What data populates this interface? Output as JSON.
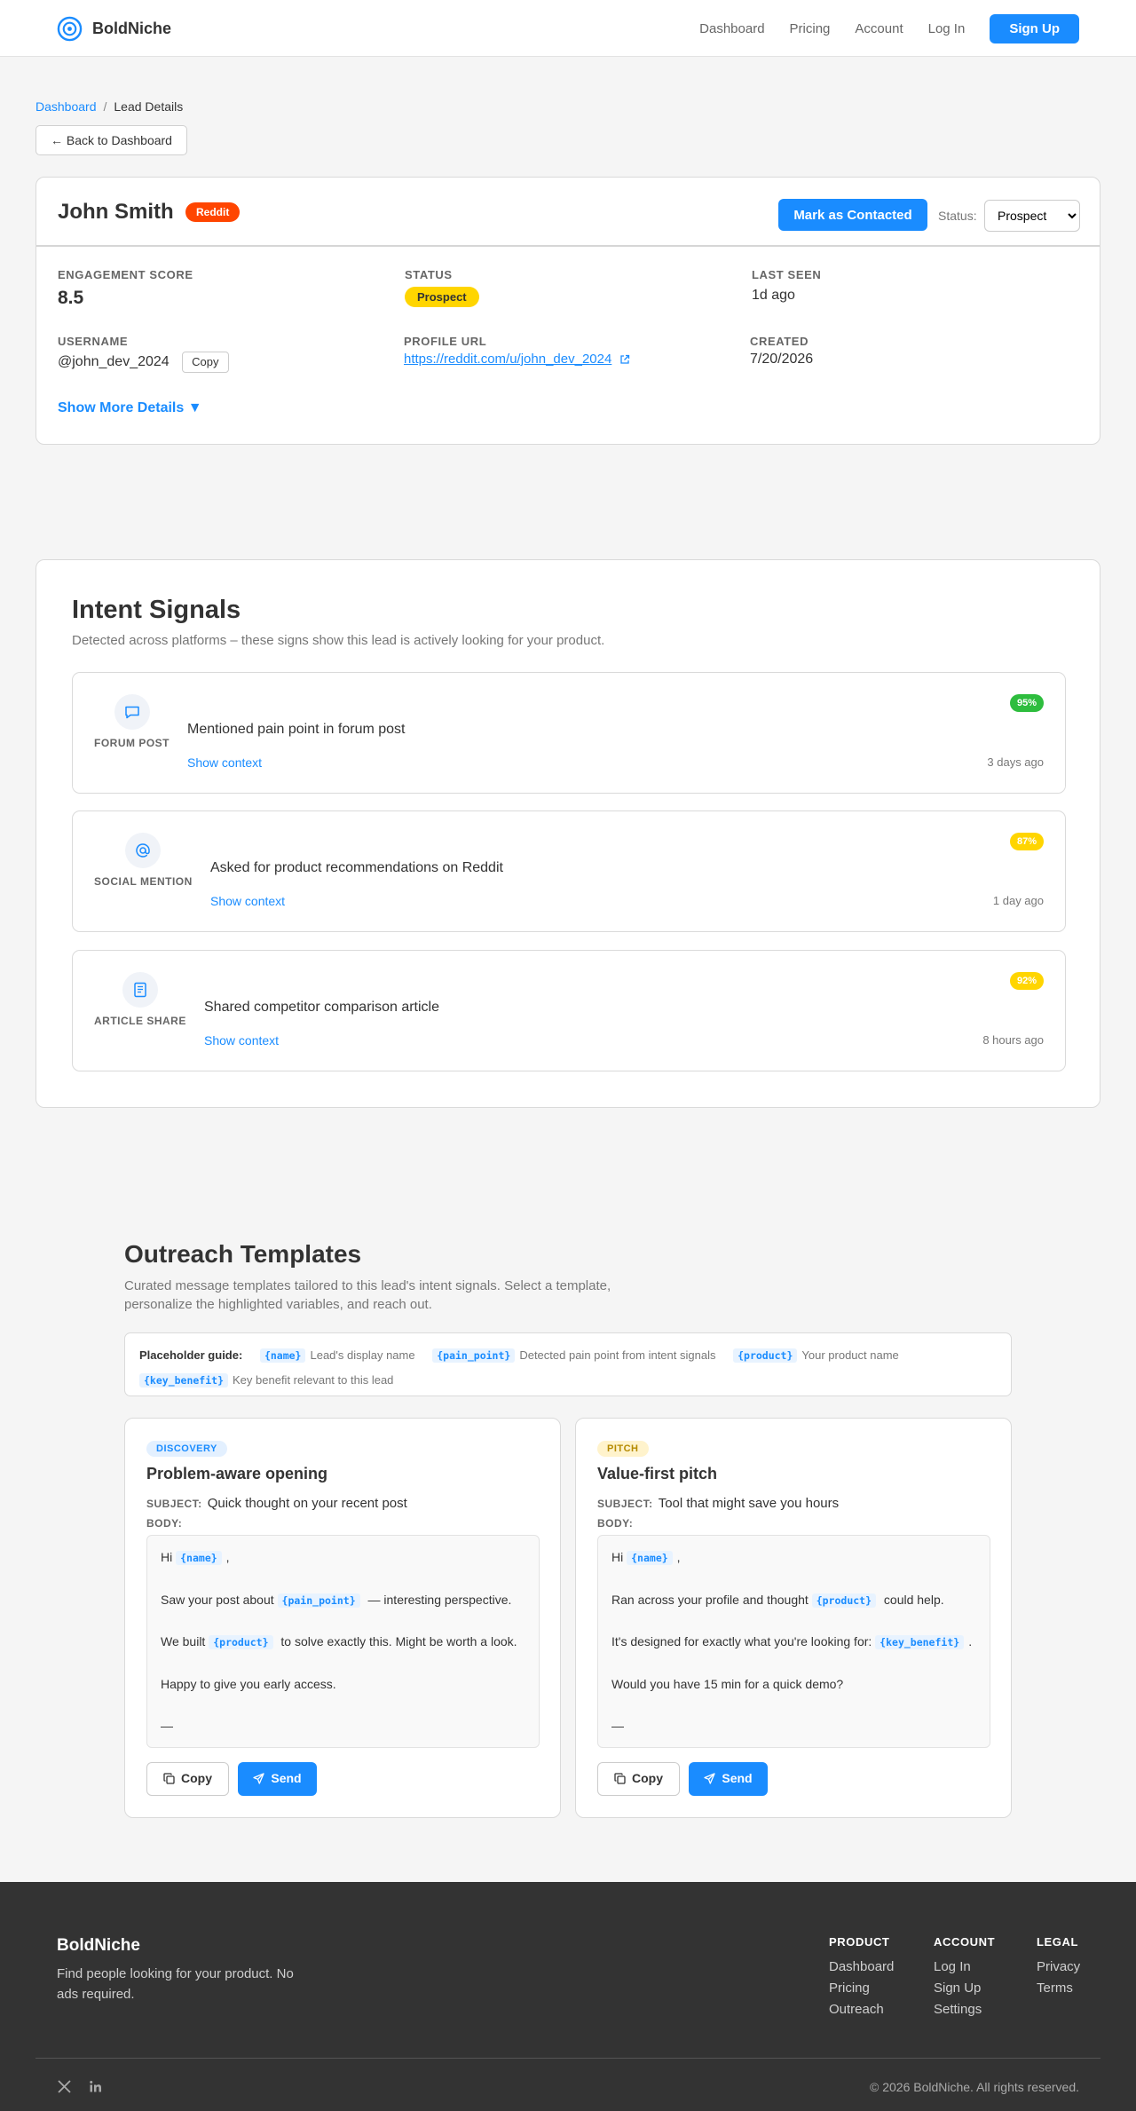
{
  "nav": {
    "brand": "BoldNiche",
    "links": [
      "Dashboard",
      "Pricing",
      "Account",
      "Log In"
    ],
    "signup": "Sign Up"
  },
  "breadcrumb": {
    "parent": "Dashboard",
    "separator": "/",
    "current": "Lead Details"
  },
  "back_button": "← Back to Dashboard",
  "lead": {
    "name": "John Smith",
    "source": "Reddit",
    "mark_contacted": "Mark as Contacted",
    "status_label": "Status:",
    "status_value": "Prospect",
    "engagement_label": "ENGAGEMENT SCORE",
    "engagement_value": "8.5",
    "status_field_label": "STATUS",
    "status_badge": "Prospect",
    "last_seen_label": "LAST SEEN",
    "last_seen_value": "1d ago",
    "username_label": "USERNAME",
    "username_value": "@john_dev_2024",
    "copy_label": "Copy",
    "profile_label": "PROFILE URL",
    "profile_value": "https://reddit.com/u/john_dev_2024",
    "created_label": "CREATED",
    "created_value": "7/20/2026",
    "show_more": "Show More Details ▼"
  },
  "intent": {
    "title": "Intent Signals",
    "subtitle": "Detected across platforms – these signs show this lead is actively looking for your product.",
    "signals": [
      {
        "type": "FORUM POST",
        "icon": "chat-bubble-icon",
        "text": "Mentioned pain point in forum post",
        "context": "Show context",
        "time": "3 days ago",
        "score": "95%",
        "score_color": "#2ebd3e"
      },
      {
        "type": "SOCIAL MENTION",
        "icon": "at-sign-icon",
        "text": "Asked for product recommendations on Reddit",
        "context": "Show context",
        "time": "1 day ago",
        "score": "87%",
        "score_color": "#ffd500"
      },
      {
        "type": "ARTICLE SHARE",
        "icon": "document-icon",
        "text": "Shared competitor comparison article",
        "context": "Show context",
        "time": "8 hours ago",
        "score": "92%",
        "score_color": "#ffd500"
      }
    ]
  },
  "templates": {
    "title": "Outreach Templates",
    "subtitle": "Curated message templates tailored to this lead's intent signals. Select a template, personalize the highlighted variables, and reach out.",
    "guide_label": "Placeholder guide:",
    "guide": [
      {
        "token": "{name}",
        "desc": "Lead's display name"
      },
      {
        "token": "{pain_point}",
        "desc": "Detected pain point from intent signals"
      },
      {
        "token": "{product}",
        "desc": "Your product name"
      },
      {
        "token": "{key_benefit}",
        "desc": "Key benefit relevant to this lead"
      }
    ],
    "subject_label": "SUBJECT:",
    "body_label": "BODY:",
    "copy": "Copy",
    "send": "Send",
    "cards": [
      {
        "tag": "DISCOVERY",
        "tag_bg": "#e3f0ff",
        "tag_color": "#1a8cff",
        "name": "Problem-aware opening",
        "subject": "Quick thought on your recent post",
        "lines": [
          [
            "Hi ",
            "{name}",
            ","
          ],
          [
            "Saw your post about ",
            "{pain_point}",
            " — interesting perspective."
          ],
          [
            "We built ",
            "{product}",
            " to solve exactly this. Might be worth a look."
          ],
          [
            "Happy to give you early access.",
            "",
            ""
          ],
          [
            "—",
            "",
            ""
          ]
        ]
      },
      {
        "tag": "PITCH",
        "tag_bg": "#fff3cc",
        "tag_color": "#b58a00",
        "name": "Value-first pitch",
        "subject": "Tool that might save you hours",
        "lines": [
          [
            "Hi ",
            "{name}",
            ","
          ],
          [
            "Ran across your profile and thought ",
            "{product}",
            " could help."
          ],
          [
            "It's designed for exactly what you're looking for: ",
            "{key_benefit}",
            "."
          ],
          [
            "Would you have 15 min for a quick demo?",
            "",
            ""
          ],
          [
            "—",
            "",
            ""
          ]
        ]
      }
    ]
  },
  "footer": {
    "brand": "BoldNiche",
    "tagline": "Find people looking for your product. No ads required.",
    "columns": [
      {
        "title": "PRODUCT",
        "links": [
          "Dashboard",
          "Pricing",
          "Outreach"
        ]
      },
      {
        "title": "ACCOUNT",
        "links": [
          "Log In",
          "Sign Up",
          "Settings"
        ]
      },
      {
        "title": "LEGAL",
        "links": [
          "Privacy",
          "Terms"
        ]
      }
    ],
    "social": [
      "x-icon",
      "linkedin-icon"
    ],
    "copyright": "© 2026 BoldNiche. All rights reserved."
  }
}
